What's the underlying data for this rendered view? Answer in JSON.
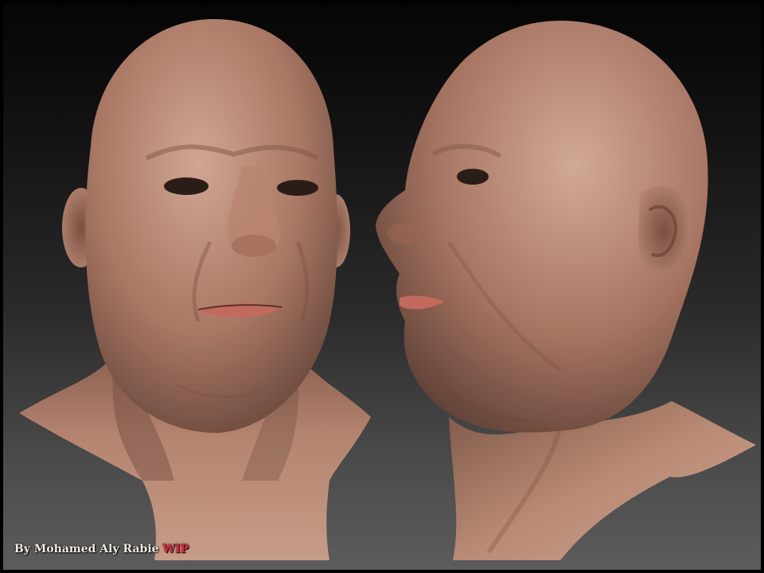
{
  "credit": {
    "prefix": "By Mohamed Aly Rabie",
    "tag": "WIP"
  },
  "colors": {
    "skin_light": "#c9a08c",
    "skin_mid": "#a87563",
    "skin_shadow": "#6b4a3d",
    "lips": "#c26a5e",
    "background_top": "#050505",
    "background_bottom": "#5c5c5c",
    "wip_accent": "#e0283a"
  }
}
